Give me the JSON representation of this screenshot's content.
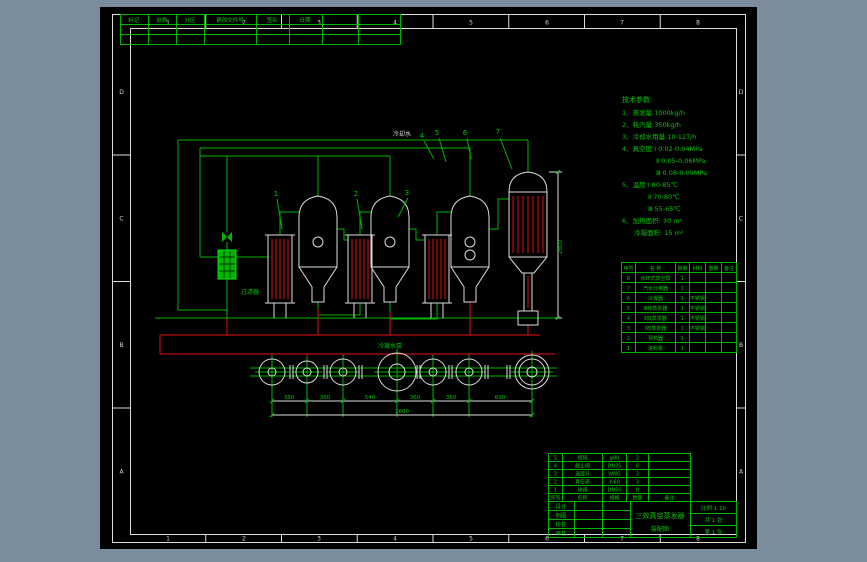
{
  "colors": {
    "background": "#7b8c9c",
    "canvas": "#000000",
    "line_green": "#00b400",
    "line_red": "#e01010",
    "line_white": "#dcdcdc",
    "text_green": "#00c800"
  },
  "frame": {
    "cols": [
      "1",
      "2",
      "3",
      "4",
      "5",
      "6",
      "7",
      "8"
    ],
    "rows": [
      "D",
      "C",
      "B",
      "A"
    ]
  },
  "revision": {
    "headers": [
      "标记",
      "处数",
      "分区",
      "更改文件号",
      "签名",
      "日期"
    ]
  },
  "tech": {
    "title": "技术参数:",
    "lines": [
      "1、蒸发量 1000kg/h",
      "2、耗汽量 350kg/h",
      "3、冷却水用量 10-12T/h",
      "4、真空度 Ⅰ 0.02-0.04MPa",
      "Ⅱ 0.05-0.06MPa",
      "Ⅲ 0.08-0.09MPa",
      "5、温度 Ⅰ 80-85℃",
      "Ⅱ 70-80℃",
      "Ⅲ 55-65℃",
      "6、加热面积: 30 m²",
      "冷凝面积: 15 m²"
    ]
  },
  "balloons": [
    "1",
    "2",
    "3",
    "4",
    "5",
    "6",
    "7"
  ],
  "labels": {
    "coolant": "冷却水",
    "filter": "过滤器",
    "pump": "冷凝水泵"
  },
  "dims": {
    "spacings": [
      "350",
      "360",
      "540",
      "360",
      "360",
      "630"
    ],
    "total": "2600",
    "height": "2800"
  },
  "parts_table": {
    "headers": [
      "序号",
      "名 称",
      "数量",
      "材料",
      "重量",
      "备注"
    ],
    "rows": [
      [
        "8",
        "水环式真空泵",
        "1",
        ""
      ],
      [
        "7",
        "汽水分离器",
        "1",
        ""
      ],
      [
        "6",
        "冷凝器",
        "1",
        "不锈钢"
      ],
      [
        "5",
        "Ⅲ效蒸发器",
        "1",
        "不锈钢"
      ],
      [
        "4",
        "Ⅱ效蒸发器",
        "1",
        "不锈钢"
      ],
      [
        "3",
        "Ⅰ效蒸发器",
        "1",
        "不锈钢"
      ],
      [
        "2",
        "预热器",
        "1",
        ""
      ],
      [
        "1",
        "进料泵",
        "1",
        ""
      ]
    ]
  },
  "strip_table": {
    "headers": [
      "序号",
      "名称",
      "规格",
      "数量",
      "备注"
    ],
    "rows": [
      [
        "5",
        "视镜",
        "φ80",
        "2"
      ],
      [
        "4",
        "截止阀",
        "DN25",
        "6"
      ],
      [
        "3",
        "温度计",
        "WNG",
        "3"
      ],
      [
        "2",
        "真空表",
        "Y-60",
        "3"
      ],
      [
        "1",
        "球阀",
        "DN50",
        "8"
      ]
    ]
  },
  "title_block": {
    "roles": [
      "设计",
      "制图",
      "校核",
      "审核"
    ],
    "title": "三效真空蒸发器",
    "subtitle": "装配图",
    "scale_line": "比例 1:10",
    "sheet1": "共 1 张",
    "sheet2": "第 1 张"
  }
}
